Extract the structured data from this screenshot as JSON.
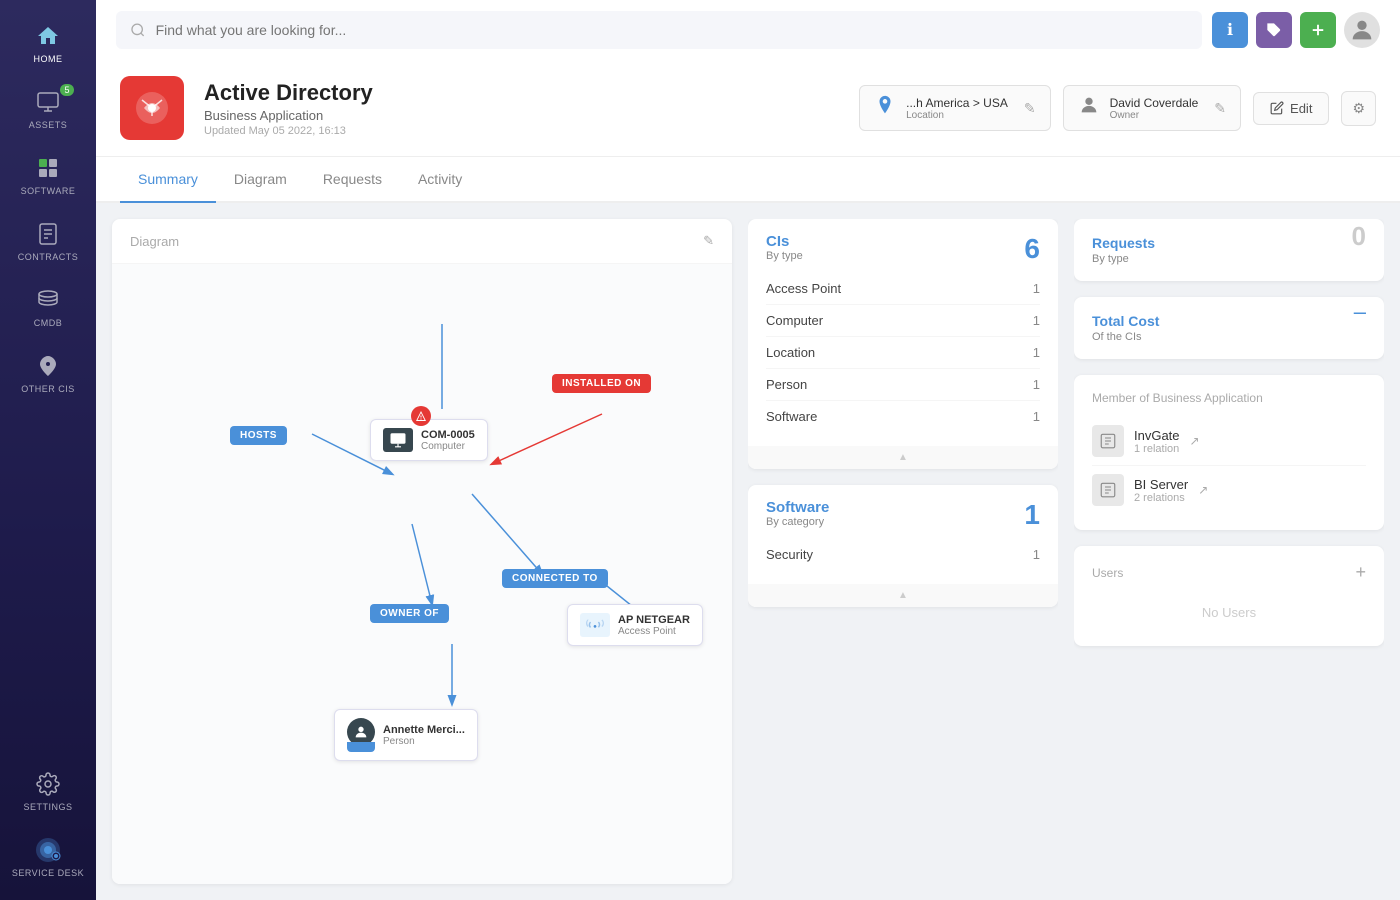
{
  "sidebar": {
    "items": [
      {
        "id": "home",
        "label": "HOME",
        "icon": "🏠",
        "badge": null,
        "active": false
      },
      {
        "id": "assets",
        "label": "ASSETS",
        "icon": "💻",
        "badge": "5",
        "active": false
      },
      {
        "id": "software",
        "label": "SOFTWARE",
        "icon": "🗂️",
        "badge": null,
        "active": false
      },
      {
        "id": "contracts",
        "label": "CONTRACTS",
        "icon": "📋",
        "badge": null,
        "active": false
      },
      {
        "id": "cmdb",
        "label": "CMDB",
        "icon": "🗄️",
        "badge": null,
        "active": false
      },
      {
        "id": "other-cis",
        "label": "OTHER CIs",
        "icon": "🌿",
        "badge": null,
        "active": false
      },
      {
        "id": "settings",
        "label": "SETTINGS",
        "icon": "⚙️",
        "badge": null,
        "active": false
      },
      {
        "id": "service-desk",
        "label": "SERVICE DESK",
        "icon": "🔵",
        "badge": null,
        "active": false
      }
    ]
  },
  "topbar": {
    "search_placeholder": "Find what you are looking for...",
    "btn_info": "ℹ",
    "btn_tag": "🏷",
    "btn_add": "+"
  },
  "header": {
    "title": "Active Directory",
    "subtitle": "Business Application",
    "updated": "Updated May 05 2022, 16:13",
    "location_label": "Location",
    "location_value": "...h America > USA",
    "owner_label": "Owner",
    "owner_value": "David Coverdale",
    "edit_label": "Edit"
  },
  "tabs": [
    {
      "id": "summary",
      "label": "Summary",
      "active": true
    },
    {
      "id": "diagram",
      "label": "Diagram",
      "active": false
    },
    {
      "id": "requests",
      "label": "Requests",
      "active": false
    },
    {
      "id": "activity",
      "label": "Activity",
      "active": false
    }
  ],
  "diagram": {
    "title": "Diagram"
  },
  "nodes": {
    "hosts": "HOSTS",
    "computer_name": "COM-0005",
    "computer_type": "Computer",
    "installed_on": "INSTALLED ON",
    "connected_to": "CONNECTED TO",
    "owner_of": "OWNER OF",
    "ap_name": "AP NETGEAR",
    "ap_type": "Access Point",
    "person_name": "Annette Merci...",
    "person_type": "Person"
  },
  "cis": {
    "title": "CIs",
    "subtitle": "By type",
    "count": "6",
    "rows": [
      {
        "label": "Access Point",
        "count": "1"
      },
      {
        "label": "Computer",
        "count": "1"
      },
      {
        "label": "Location",
        "count": "1"
      },
      {
        "label": "Person",
        "count": "1"
      },
      {
        "label": "Software",
        "count": "1"
      }
    ]
  },
  "software": {
    "title": "Software",
    "subtitle": "By category",
    "count": "1",
    "rows": [
      {
        "label": "Security",
        "count": "1"
      }
    ]
  },
  "requests": {
    "title": "Requests",
    "subtitle": "By type",
    "count": "0"
  },
  "total_cost": {
    "title": "Total Cost",
    "subtitle": "Of the CIs",
    "value": "–"
  },
  "members": {
    "label": "Member of Business Application",
    "items": [
      {
        "name": "InvGate",
        "relations": "1 relation"
      },
      {
        "name": "BI Server",
        "relations": "2 relations"
      }
    ]
  },
  "users": {
    "title": "Users",
    "no_users": "No Users",
    "add_icon": "+"
  }
}
